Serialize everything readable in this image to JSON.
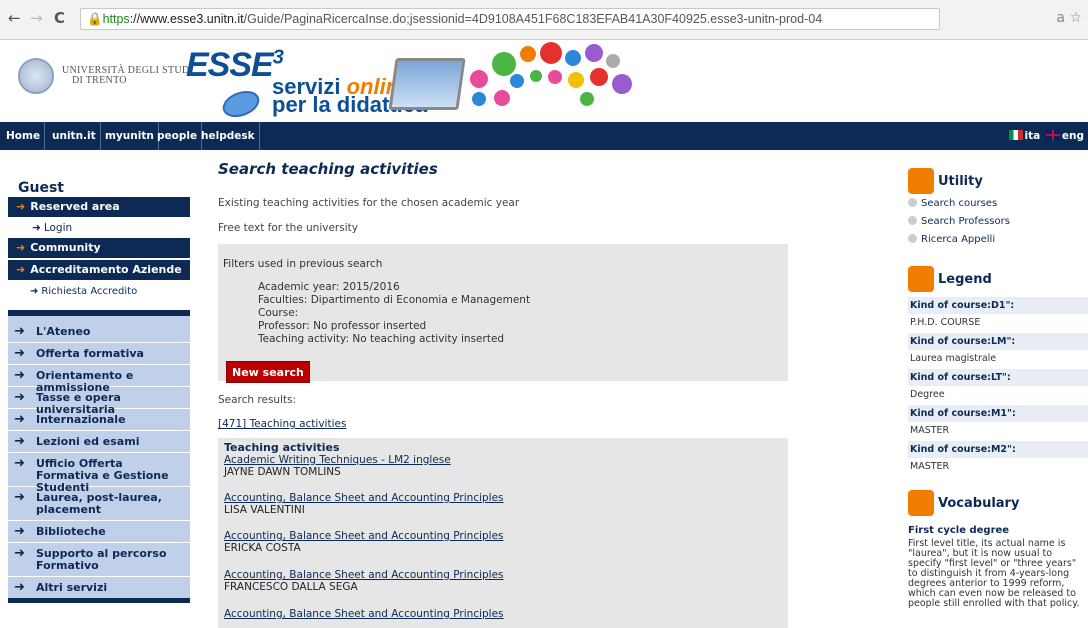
{
  "browser": {
    "back_icon": "←",
    "forward_icon": "→",
    "reload_icon": "C",
    "url_scheme": "https",
    "url_host": "://www.esse3.unitn.it",
    "url_path": "/Guide/PaginaRicercaInse.do;jsessionid=4D9108A451F68C183EFAB41A30F40925.esse3-unitn-prod-04",
    "translate_icon": "a",
    "star_icon": "☆"
  },
  "header": {
    "university_line1": "UNIVERSITÀ DEGLI STUDI",
    "university_line2": "DI TRENTO",
    "logo_text": "ESSE",
    "logo_sup": "3",
    "servizi_1": "servizi ",
    "servizi_online": "online",
    "servizi_2": "per la didattica"
  },
  "topnav": {
    "items": [
      "Home",
      "unitn.it",
      "myunitn",
      "people",
      "helpdesk"
    ],
    "lang_ita": "ita",
    "lang_eng": "eng"
  },
  "sidebar": {
    "guest": "Guest",
    "reserved": "Reserved area",
    "login": "Login",
    "community": "Community",
    "accreditamento": "Accreditamento Aziende",
    "richiesta": "Richiesta Accredito",
    "menu": [
      "L'Ateneo",
      "Offerta formativa",
      "Orientamento e ammissione",
      "Tasse e opera universitaria",
      "Internazionale",
      "Lezioni ed esami",
      "Ufficio Offerta Formativa e Gestione Studenti",
      "Laurea, post-laurea, placement",
      "Biblioteche",
      "Supporto al percorso Formativo",
      "Altri servizi"
    ]
  },
  "main": {
    "title": "Search teaching activities",
    "subtitle": "Existing teaching activities for the chosen academic year",
    "free_text": "Free text for the university",
    "filters_title": "Filters used in previous search",
    "filters": [
      "Academic year: 2015/2016",
      "Faculties: Dipartimento di Economia e Management",
      "Course:",
      "Professor: No professor inserted",
      "Teaching activity: No teaching activity inserted"
    ],
    "new_search": "New search",
    "search_results": "Search results:",
    "results_count": "[471] Teaching activities",
    "results_header": "Teaching activities",
    "results": [
      {
        "course": "Academic Writing Techniques - LM2 inglese",
        "teacher": "JAYNE DAWN TOMLINS"
      },
      {
        "course": "Accounting, Balance Sheet and Accounting Principles",
        "teacher": "LISA VALENTINI"
      },
      {
        "course": "Accounting, Balance Sheet and Accounting Principles",
        "teacher": "ERICKA COSTA"
      },
      {
        "course": "Accounting, Balance Sheet and Accounting Principles",
        "teacher": "FRANCESCO DALLA SEGA"
      },
      {
        "course": "Accounting, Balance Sheet and Accounting Principles",
        "teacher": ""
      }
    ]
  },
  "right": {
    "utility_title": "Utility",
    "utility_links": [
      "Search courses",
      "Search Professors",
      "Ricerca Appelli"
    ],
    "legend_title": "Legend",
    "legend": [
      {
        "key": "Kind of course:D1\":",
        "value": "P.H.D. COURSE"
      },
      {
        "key": "Kind of course:LM\":",
        "value": "Laurea magistrale"
      },
      {
        "key": "Kind of course:LT\":",
        "value": "Degree"
      },
      {
        "key": "Kind of course:M1\":",
        "value": "MASTER"
      },
      {
        "key": "Kind of course:M2\":",
        "value": "MASTER"
      }
    ],
    "vocabulary_title": "Vocabulary",
    "voc_term": "First cycle degree",
    "voc_text": "First level title, its actual name is \"laurea\", but it is now usual to specify \"first level\" or \"three years\" to distinguish it from 4-years-long degrees anterior to 1999 reform, which can even now be released to people still enrolled with that policy."
  },
  "colors": {
    "navy": "#0d2a55",
    "orange": "#f07c00",
    "red_button": "#b00000",
    "sidebar_bg": "#bfd0e8"
  }
}
